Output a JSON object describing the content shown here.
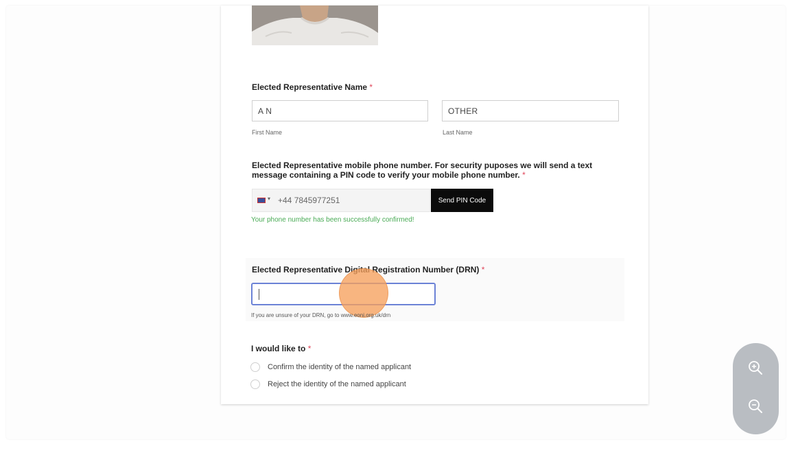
{
  "form": {
    "name_label": "Elected Representative Name",
    "required_mark": "*",
    "first_name_value": "A N",
    "first_name_sublabel": "First Name",
    "last_name_value": "OTHER",
    "last_name_sublabel": "Last Name",
    "phone_label_line1": "Elected Representative mobile phone number. For security puposes we will send a text",
    "phone_label_line2": "message containing a PIN code to verify your mobile phone number.",
    "phone_value": "+44 7845977251",
    "send_pin_label": "Send PIN Code",
    "phone_success": "Your phone number has been successfully confirmed!",
    "drn_label": "Elected Representative Digital Registration Number (DRN)",
    "drn_value": "",
    "drn_help": "If you are unsure of your DRN, go to www.eoni.org.uk/drn",
    "action_label": "I would like to",
    "options": [
      "Confirm the identity of the named applicant",
      "Reject the identity of the named applicant"
    ]
  },
  "icons": {
    "flag": "uk-flag-icon",
    "zoom_in": "zoom-in-icon",
    "zoom_out": "zoom-out-icon"
  },
  "colors": {
    "required": "#e0455a",
    "success": "#4aab56",
    "focus_border": "#6b82d6",
    "click_indicator": "#f6a05c",
    "button_bg": "#0b0b0b"
  }
}
